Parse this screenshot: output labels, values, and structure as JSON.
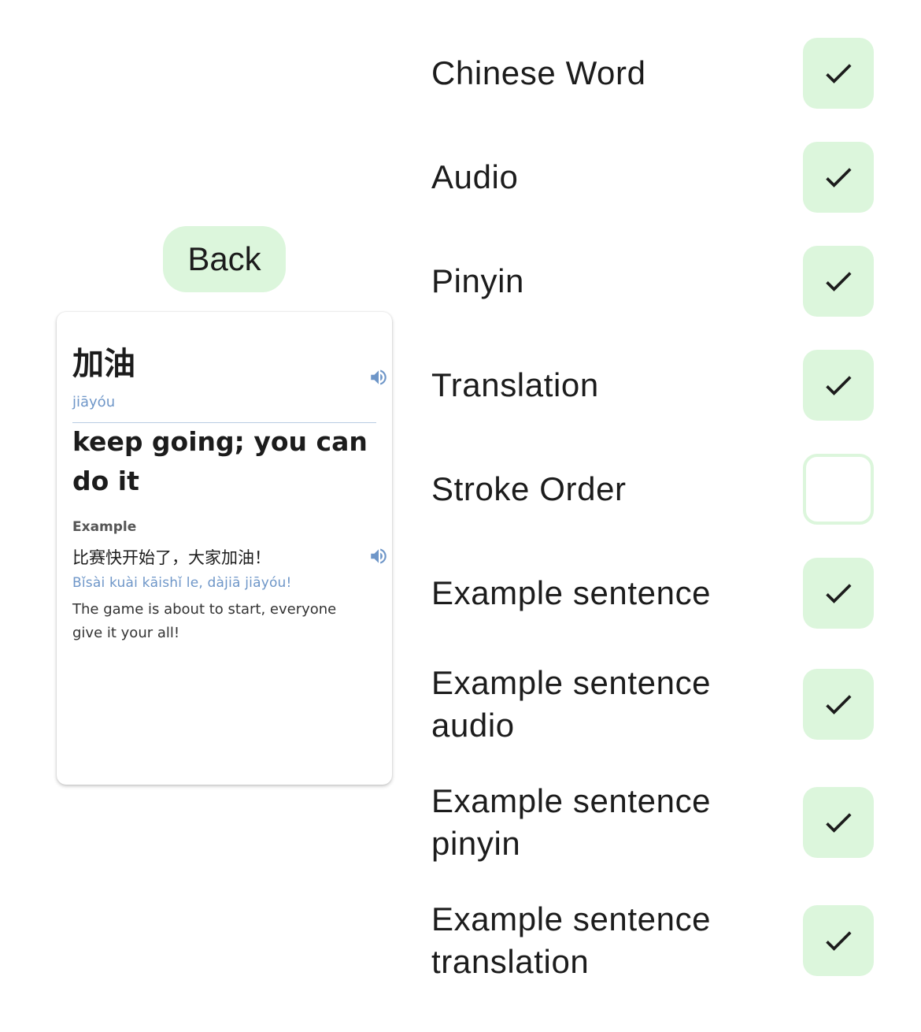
{
  "back_button": {
    "label": "Back"
  },
  "card": {
    "word": "加油",
    "pinyin": "jiāyóu",
    "translation": "keep going; you can do it",
    "example_label": "Example",
    "example_sentence": "比赛快开始了，大家加油！",
    "example_pinyin": "Bǐsài kuài kāishǐ le, dàjiā jiāyóu!",
    "example_translation": "The game is about to start, everyone give it your all!",
    "word_audio_icon": "speaker-icon",
    "example_audio_icon": "speaker-icon"
  },
  "options": [
    {
      "label": "Chinese Word",
      "checked": true
    },
    {
      "label": "Audio",
      "checked": true
    },
    {
      "label": "Pinyin",
      "checked": true
    },
    {
      "label": "Translation",
      "checked": true
    },
    {
      "label": "Stroke Order",
      "checked": false
    },
    {
      "label": "Example sentence",
      "checked": true
    },
    {
      "label": "Example sentence audio",
      "checked": true
    },
    {
      "label": "Example sentence pinyin",
      "checked": true
    },
    {
      "label": "Example sentence translation",
      "checked": true
    }
  ],
  "colors": {
    "accent_green": "#dcf6dc",
    "pinyin_blue": "#6e96c8",
    "text": "#1c1c1c"
  }
}
